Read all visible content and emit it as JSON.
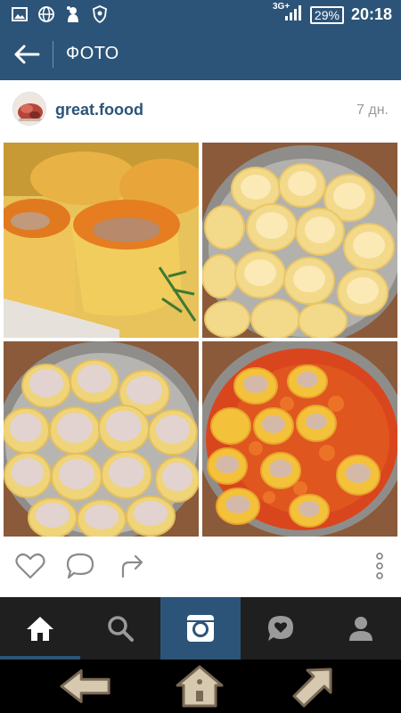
{
  "status_bar": {
    "network": "3G+",
    "battery": "29%",
    "time": "20:18",
    "icons": [
      "image-icon",
      "globe-icon",
      "mascot-icon",
      "shield-icon",
      "signal-icon"
    ]
  },
  "app_bar": {
    "title": "ФОТО",
    "back_icon": "arrow-left-icon"
  },
  "post": {
    "username": "great.foood",
    "time_ago": "7 дн.",
    "photos": [
      {
        "name": "stuffed-potatoes-carrot-topping"
      },
      {
        "name": "hollowed-potatoes-in-pan"
      },
      {
        "name": "potatoes-stuffed-with-meat"
      },
      {
        "name": "potatoes-in-tomato-sauce"
      }
    ],
    "actions": [
      "heart-icon",
      "comment-icon",
      "share-icon",
      "more-icon"
    ]
  },
  "tab_bar": {
    "tabs": [
      {
        "name": "tab-home",
        "icon": "home-icon",
        "state": "selected"
      },
      {
        "name": "tab-search",
        "icon": "search-icon"
      },
      {
        "name": "tab-camera",
        "icon": "camera-icon",
        "state": "highlighted"
      },
      {
        "name": "tab-activity",
        "icon": "heart-bubble-icon"
      },
      {
        "name": "tab-profile",
        "icon": "profile-icon"
      }
    ]
  },
  "system_nav": [
    "back-icon",
    "home-icon",
    "recents-icon"
  ],
  "colors": {
    "brand": "#2c5478",
    "username": "#2c5478",
    "tab_bar": "#1f1f1f",
    "meta_text": "#9a9a9a"
  }
}
